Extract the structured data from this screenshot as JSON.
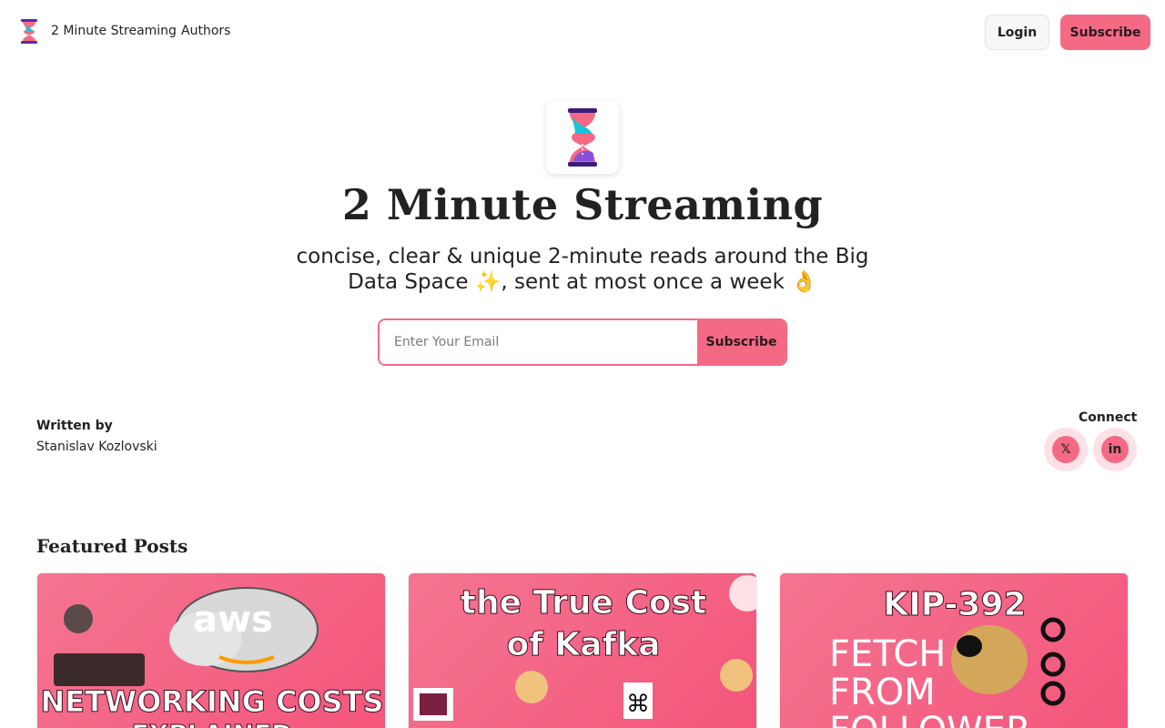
{
  "nav": {
    "brand": "2 Minute Streaming",
    "authors": "Authors",
    "login": "Login",
    "subscribe": "Subscribe"
  },
  "hero": {
    "title": "2 Minute Streaming",
    "subtitle": "concise, clear & unique 2-minute reads around the Big Data Space ✨, sent at most once a week 👌",
    "email_placeholder": "Enter Your Email",
    "subscribe": "Subscribe"
  },
  "author": {
    "written_by": "Written by",
    "name": "Stanislav Kozlovski"
  },
  "connect": {
    "label": "Connect",
    "links": [
      {
        "icon": "x-icon",
        "glyph": "𝕏"
      },
      {
        "icon": "linkedin-icon",
        "glyph": "in"
      }
    ]
  },
  "featured": {
    "title": "Featured Posts",
    "cards": [
      {
        "line1": "aws",
        "line2": "NETWORKING COSTS",
        "line3": "EXPLAINED"
      },
      {
        "line1": "the True Cost",
        "line2": "of Kafka"
      },
      {
        "line1": "KIP-392",
        "line2": "FETCH",
        "line3": "FROM",
        "line4": "FOLLOWER"
      }
    ]
  },
  "colors": {
    "accent": "#f46a84",
    "accent_light": "#fde1e6"
  }
}
